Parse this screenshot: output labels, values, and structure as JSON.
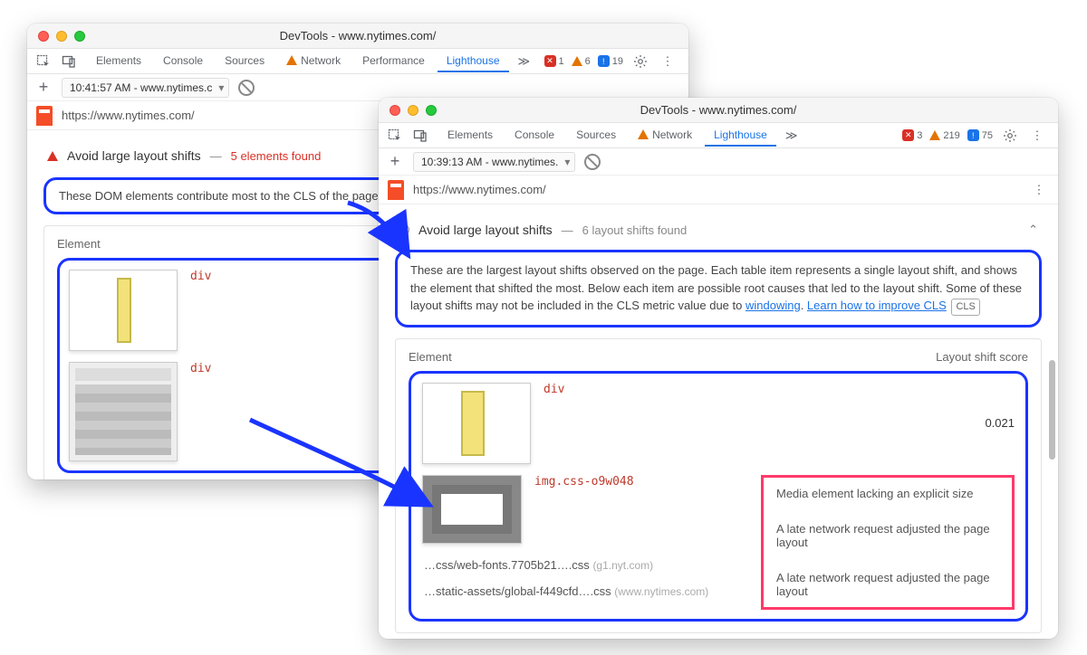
{
  "left": {
    "window_title": "DevTools - www.nytimes.com/",
    "tabs": [
      "Elements",
      "Console",
      "Sources",
      "Network",
      "Performance",
      "Lighthouse"
    ],
    "active_tab": "Lighthouse",
    "stats": {
      "errors": "1",
      "warnings": "6",
      "issues": "19"
    },
    "report_label": "10:41:57 AM - www.nytimes.c",
    "url": "https://www.nytimes.com/",
    "audit_title": "Avoid large layout shifts",
    "audit_subtitle": "5 elements found",
    "desc": "These DOM elements contribute most to the CLS of the page.",
    "element_header": "Element",
    "elements": [
      {
        "code": "div"
      },
      {
        "code": "div"
      }
    ]
  },
  "right": {
    "window_title": "DevTools - www.nytimes.com/",
    "tabs": [
      "Elements",
      "Console",
      "Sources",
      "Network",
      "Lighthouse"
    ],
    "active_tab": "Lighthouse",
    "stats": {
      "errors": "3",
      "warnings": "219",
      "issues": "75"
    },
    "report_label": "10:39:13 AM - www.nytimes.",
    "url": "https://www.nytimes.com/",
    "audit_title": "Avoid large layout shifts",
    "audit_subtitle": "6 layout shifts found",
    "desc_a": "These are the largest layout shifts observed on the page. Each table item represents a single layout shift, and shows the element that shifted the most. Below each item are possible root causes that led to the layout shift. Some of these layout shifts may not be included in the CLS metric value due to ",
    "desc_link1": "windowing",
    "desc_mid": ". ",
    "desc_link2": "Learn how to improve CLS",
    "badge": "CLS",
    "element_header": "Element",
    "score_header": "Layout shift score",
    "row1": {
      "code": "div",
      "score": "0.021"
    },
    "row2": {
      "code": "img.css-o9w048"
    },
    "files": [
      {
        "name": "…css/web-fonts.7705b21….css",
        "host": "(g1.nyt.com)"
      },
      {
        "name": "…static-assets/global-f449cfd….css",
        "host": "(www.nytimes.com)"
      }
    ],
    "notes": [
      "Media element lacking an explicit size",
      "A late network request adjusted the page layout",
      "A late network request adjusted the page layout"
    ]
  }
}
